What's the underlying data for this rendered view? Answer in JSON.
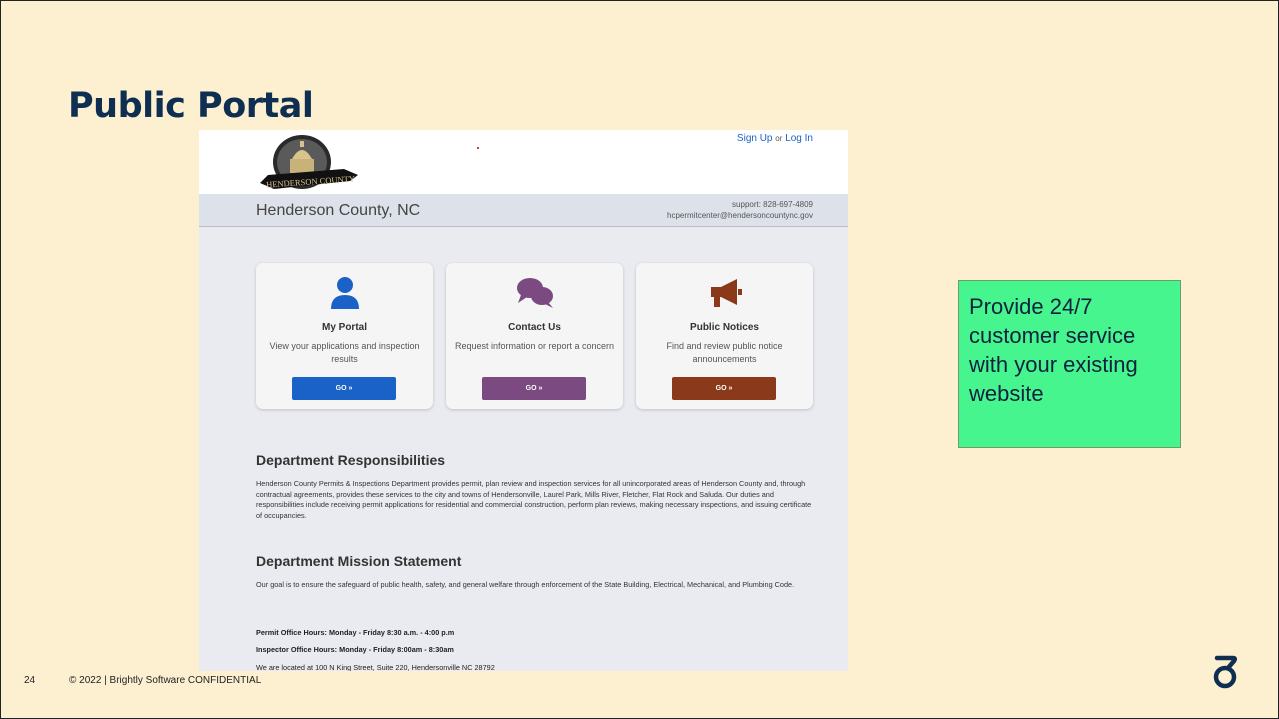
{
  "slide": {
    "title": "Public Portal",
    "page_number": "24",
    "footer_text": "© 2022 | Brightly Software CONFIDENTIAL",
    "callout": "Provide 24/7 customer service with your existing website",
    "brand_icon": "brightly-logo-icon",
    "colors": {
      "background": "#fcf0d0",
      "title": "#0f2f52",
      "callout": "#47f58e"
    }
  },
  "portal": {
    "logo_text": "HENDERSON COUNTY",
    "signup_label": "Sign Up",
    "or_label": "or",
    "login_label": "Log In",
    "county_name": "Henderson County, NC",
    "support_phone": "support: 828-697-4809",
    "support_email": "hcpermitcenter@hendersoncountync.gov",
    "cards": [
      {
        "icon": "user-icon",
        "title": "My Portal",
        "desc": "View your applications and inspection results",
        "button": "GO »",
        "color": "#1a62c8"
      },
      {
        "icon": "chat-bubbles-icon",
        "title": "Contact Us",
        "desc": "Request information or report a concern",
        "button": "GO »",
        "color": "#7a4a80"
      },
      {
        "icon": "megaphone-icon",
        "title": "Public Notices",
        "desc": "Find and review public notice announcements",
        "button": "GO »",
        "color": "#8a3a1a"
      }
    ],
    "responsibilities": {
      "heading": "Department Responsibilities",
      "text": "Henderson County Permits & Inspections Department provides permit, plan review and inspection services for all unincorporated areas of Henderson County and, through contractual agreements, provides these services to the city and towns of Hendersonville, Laurel Park, Mills River, Fletcher, Flat Rock and Saluda. Our duties and responsibilities include receiving permit applications for residential and commercial construction, perform plan reviews, making necessary inspections, and issuing certificate of occupancies."
    },
    "mission": {
      "heading": "Department Mission Statement",
      "text": "Our goal is to ensure the safeguard of public health, safety, and general welfare through enforcement of the State Building, Electrical, Mechanical, and Plumbing Code."
    },
    "permit_hours": "Permit Office Hours:  Monday - Friday  8:30 a.m. - 4:00 p.m",
    "inspector_hours": "Inspector Office Hours: Monday - Friday  8:00am - 8:30am",
    "location": "We are located at 100 N King Street, Suite 220, Hendersonville NC  28792"
  }
}
